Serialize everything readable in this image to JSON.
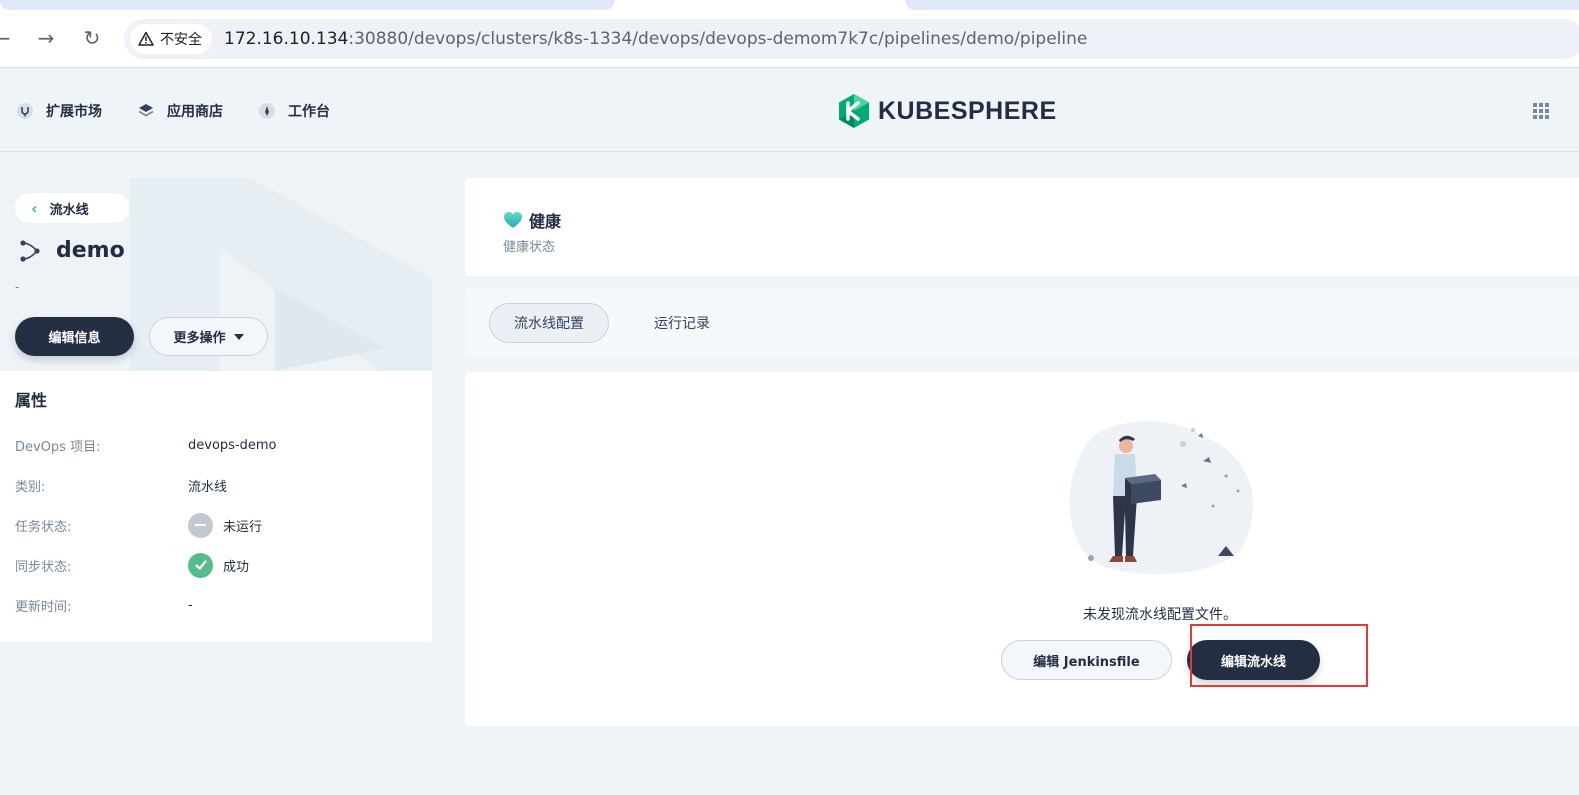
{
  "browser": {
    "insecure_label": "不安全",
    "url_host": "172.16.10.134",
    "url_rest": ":30880/devops/clusters/k8s-1334/devops/devops-demom7k7c/pipelines/demo/pipeline",
    "back_glyph": "←",
    "forward_glyph": "→",
    "reload_glyph": "↻"
  },
  "topnav": {
    "items": [
      {
        "label": "扩展市场",
        "icon": "extension-icon"
      },
      {
        "label": "应用商店",
        "icon": "app-store-icon"
      },
      {
        "label": "工作台",
        "icon": "workbench-icon"
      }
    ],
    "logo_text": "KUBESPHERE"
  },
  "left": {
    "back_label": "流水线",
    "title": "demo",
    "description": "-",
    "edit_info_label": "编辑信息",
    "more_actions_label": "更多操作",
    "props_title": "属性",
    "props": [
      {
        "label": "DevOps 项目:",
        "value": "devops-demo"
      },
      {
        "label": "类别:",
        "value": "流水线"
      },
      {
        "label": "任务状态:",
        "value": "未运行",
        "status": "not-run"
      },
      {
        "label": "同步状态:",
        "value": "成功",
        "status": "success"
      },
      {
        "label": "更新时间:",
        "value": "-"
      }
    ]
  },
  "health": {
    "title": "健康",
    "subtitle": "健康状态"
  },
  "tabs": [
    {
      "label": "流水线配置",
      "active": true
    },
    {
      "label": "运行记录",
      "active": false
    }
  ],
  "empty": {
    "message": "未发现流水线配置文件。",
    "edit_jenkinsfile_label": "编辑 Jenkinsfile",
    "edit_pipeline_label": "编辑流水线"
  },
  "colors": {
    "primary_dark": "#242e42",
    "accent_green": "#55bc8a",
    "highlight_red": "#e53935"
  }
}
